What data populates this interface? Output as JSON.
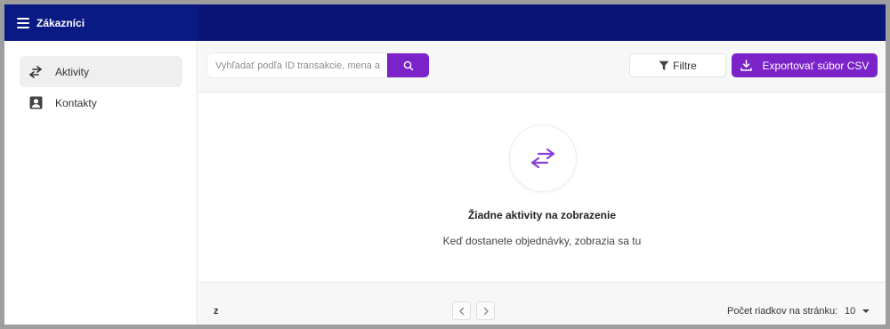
{
  "app": {
    "title": "Zákazníci"
  },
  "sidebar": {
    "items": [
      {
        "label": "Aktivity",
        "icon": "arrows-exchange-icon",
        "active": true
      },
      {
        "label": "Kontakty",
        "icon": "contact-card-icon",
        "active": false
      }
    ]
  },
  "toolbar": {
    "search_placeholder": "Vyhľadať podľa ID transakcie, mena a",
    "filter_label": "Filtre",
    "export_label": "Exportovať súbor CSV"
  },
  "empty_state": {
    "title": "Žiadne aktivity na zobrazenie",
    "subtitle": "Keď dostanete objednávky, zobrazia sa tu"
  },
  "pagination": {
    "page_info": "z",
    "rows_label": "Počet riadkov na stránku:",
    "rows_value": "10"
  },
  "colors": {
    "topbar": "#0b1578",
    "accent": "#7b22c8",
    "empty_icon": "#8a3fd6"
  }
}
